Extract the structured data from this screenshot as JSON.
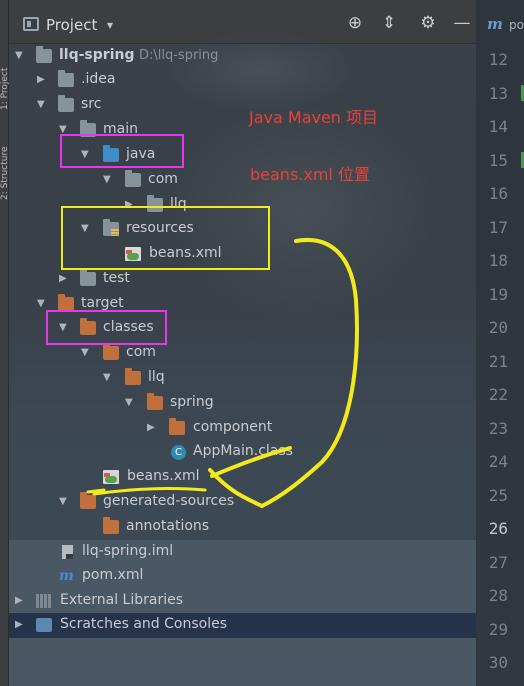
{
  "sidebar_strip": {
    "labels": [
      "1: Project",
      "2: Structure"
    ]
  },
  "header": {
    "title": "Project",
    "caret": "▾",
    "tools": [
      {
        "name": "locate-icon",
        "glyph": "⊕"
      },
      {
        "name": "collapse-icon",
        "glyph": "⇕"
      },
      {
        "name": "gear-icon",
        "glyph": "⚙"
      },
      {
        "name": "hide-icon",
        "glyph": "—"
      }
    ]
  },
  "tree": {
    "root": {
      "label": "llq-spring",
      "path": "D:\\llq-spring"
    },
    "idea": ".idea",
    "src": "src",
    "main": "main",
    "java": "java",
    "com": "com",
    "llq": "llq",
    "resources": "resources",
    "beans_xml": "beans.xml",
    "test": "test",
    "target": "target",
    "classes": "classes",
    "t_com": "com",
    "t_llq": "llq",
    "t_spring": "spring",
    "t_component": "component",
    "t_appmain": "AppMain.class",
    "t_beans": "beans.xml",
    "generated_sources": "generated-sources",
    "annotations": "annotations",
    "iml": "llq-spring.iml",
    "pom": "pom.xml",
    "external_libraries": "External Libraries",
    "scratches": "Scratches and Consoles"
  },
  "annotations": {
    "title": "Java Maven 项目",
    "subtitle": "beans.xml 位置"
  },
  "editor": {
    "tab_icon": "m",
    "tab_label": "po",
    "line_numbers": [
      "12",
      "13",
      "14",
      "15",
      "16",
      "17",
      "18",
      "19",
      "20",
      "21",
      "22",
      "23",
      "24",
      "25",
      "26",
      "27",
      "28",
      "29",
      "30"
    ],
    "current_line": "26"
  },
  "colors": {
    "annotation_red": "#e8423a",
    "box_magenta": "#e437ee",
    "box_yellow": "#f3ea1a",
    "folder_blue": "#3f8ec9",
    "folder_orange": "#c1703c"
  }
}
